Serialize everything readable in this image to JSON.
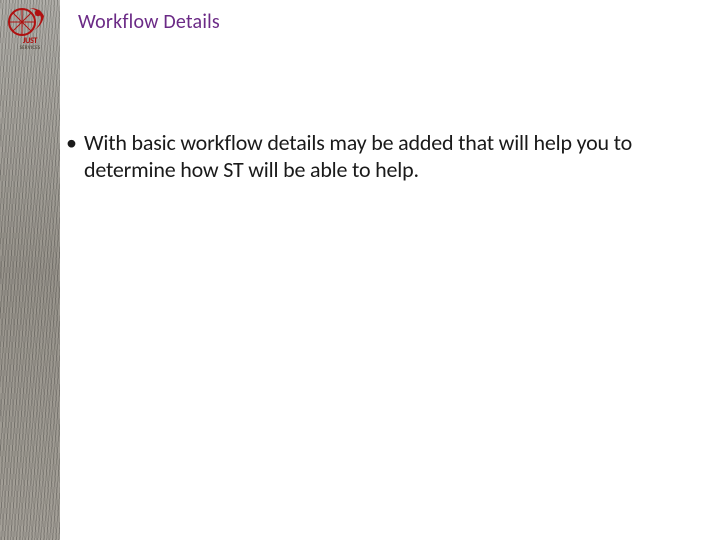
{
  "logo": {
    "name": "JUST",
    "sub": "SERVICES"
  },
  "title": "Workflow Details",
  "bullets": [
    "With basic workflow details may be added that will help you to determine how ST will be able to help."
  ],
  "colors": {
    "title": "#6b2a86",
    "logo_red": "#b01010"
  }
}
